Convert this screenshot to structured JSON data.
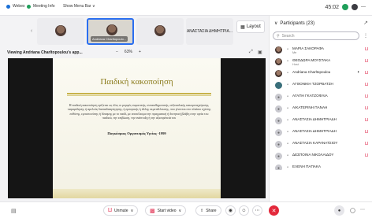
{
  "topbar": {
    "items": [
      {
        "label": "Webex",
        "color": "#1a6fd6"
      },
      {
        "label": "Meeting Info",
        "color": "#1f9f5a"
      },
      {
        "label": "Show Menu Bar ∨",
        "color": ""
      }
    ],
    "time": "45:02"
  },
  "thumbnails": [
    {
      "name": "",
      "kind": "photo"
    },
    {
      "name": "Andriana Charltopoulo...",
      "kind": "active"
    },
    {
      "name": "",
      "kind": "photo"
    },
    {
      "name": "ΑΝΑΣΤΑΣΙΑ ΔΗΜΗΤΡΙΑ...",
      "kind": "text"
    }
  ],
  "layout_button": "Layout",
  "share": {
    "label": "Viewing Andriana Charltopoulou's app...",
    "zoom_out": "−",
    "zoom_level": "63%",
    "zoom_in": "+"
  },
  "slide": {
    "title": "Παιδική κακοποίηση",
    "body": "Η παιδική κακοποίηση ορίζεται ως όλες οι μορφές σωματικής, συναισθηματικής, σεξουαλικής κακομεταχείρισης, παραμέλησης ή αμελούς διαπαιδααγώγησης, ή εμπορικής ή άλλης εκμετάλλευσης, που γίνονται στο πλαίσιο σχέσης ευθύνης, εμπιστοσύνης ή δύναμης με το παιδί, με αποτέλεσμα την πραγματική ή δυνητική βλάβη στην υγεία του παιδιού, την επιβίωση, την ανάπτυξη ή την αξιοπρέπειά του",
    "source": "Παγκόσμιος Οργανισμός Υγείας -1999"
  },
  "toolbar": {
    "unmute": "Unmute",
    "start_video": "Start video",
    "share": "Share"
  },
  "participants": {
    "title": "Participants (23)",
    "search_placeholder": "Search",
    "list": [
      {
        "name": "ΜΑΡΙΑ ΣΑΚΟΡΑΦΑ",
        "role": "Me",
        "avatar": "photo"
      },
      {
        "name": "ΘΕΟΔΩΡΑ ΜΟΥΣΤΑΚΑ",
        "role": "Host",
        "avatar": "photo"
      },
      {
        "name": "Andriana Charltopoulou",
        "role": "",
        "avatar": "photo",
        "sharing": true
      },
      {
        "name": "ΑΓΘΟΝΙΚΗ ΤΖΟΡΒΑΤΖΗ",
        "role": "",
        "avatar": "teal"
      },
      {
        "name": "ΑΓΑΠΗ ΓΚΑΤΖΟΦΛΙΑ",
        "role": "",
        "avatar": "grey"
      },
      {
        "name": "ΑΙΚΑΤΕΡΙΝΗ ΠΑΝΑΗ",
        "role": "",
        "avatar": "grey"
      },
      {
        "name": "ΑΝΑΣΤΑΣΙΑ ΔΗΜΗΤΡΙΑΔΗ",
        "role": "",
        "avatar": "grey"
      },
      {
        "name": "ΑΝΑΣΤΑΣΙΑ ΔΗΜΗΤΡΙΑΔΗ",
        "role": "",
        "avatar": "grey"
      },
      {
        "name": "ΑΝΑΣΤΑΣΙΑ ΚΑΡΑΝΑΤΣΙΟΥ",
        "role": "",
        "avatar": "grey"
      },
      {
        "name": "ΔΕΣΠΟΙΝΑ ΝΙΚΟΛΑΙΔΟΥ",
        "role": "",
        "avatar": "grey"
      },
      {
        "name": "ΕΛΕΝΗ ΠΑΠΑΚΑ",
        "role": "",
        "avatar": "grey"
      }
    ]
  },
  "colors": {
    "accent": "#2a6ef0",
    "muted_red": "#e0284b",
    "end_red": "#e3283b",
    "slide_title": "#8a7a1a"
  }
}
